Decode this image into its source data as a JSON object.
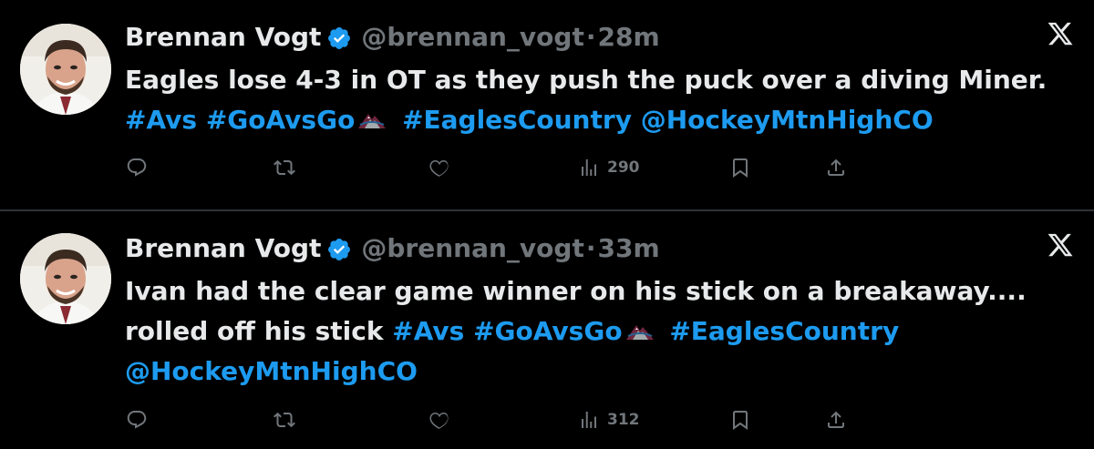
{
  "tweets": [
    {
      "author_name": "Brennan Vogt",
      "author_handle": "@brennan_vogt",
      "separator": "·",
      "time": "28m",
      "text_lines": [
        [
          {
            "text": "Eagles lose 4-3 in OT as they push the puck over a diving Miner.",
            "link": false
          }
        ],
        [
          {
            "text": "#Avs",
            "link": true
          },
          {
            "text": " ",
            "link": false
          },
          {
            "text": "#GoAvsGo",
            "link": true
          },
          {
            "emoji": "avalanche-logo-emoji"
          },
          {
            "text": " ",
            "link": false
          },
          {
            "text": "#EaglesCountry",
            "link": true
          },
          {
            "text": " ",
            "link": false
          },
          {
            "text": "@HockeyMtnHighCO",
            "link": true
          }
        ]
      ],
      "views": "290"
    },
    {
      "author_name": "Brennan Vogt",
      "author_handle": "@brennan_vogt",
      "separator": "·",
      "time": "33m",
      "text_lines": [
        [
          {
            "text": "Ivan had the clear game winner on his stick on a breakaway....",
            "link": false
          }
        ],
        [
          {
            "text": "rolled off his stick ",
            "link": false
          },
          {
            "text": "#Avs",
            "link": true
          },
          {
            "text": " ",
            "link": false
          },
          {
            "text": "#GoAvsGo",
            "link": true
          },
          {
            "emoji": "avalanche-logo-emoji"
          },
          {
            "text": " ",
            "link": false
          },
          {
            "text": "#EaglesCountry",
            "link": true
          }
        ],
        [
          {
            "text": "@HockeyMtnHighCO",
            "link": true
          }
        ]
      ],
      "views": "312"
    }
  ],
  "icons": {
    "verified": "verified-badge-icon",
    "platform": "x-logo-icon",
    "reply": "reply-icon",
    "retweet": "retweet-icon",
    "like": "heart-icon",
    "views": "views-bar-chart-icon",
    "bookmark": "bookmark-icon",
    "share": "share-icon"
  },
  "colors": {
    "background": "#000000",
    "text_primary": "#e7e9ea",
    "text_secondary": "#71767b",
    "link": "#1d9bf0",
    "verified": "#1d9bf0",
    "divider": "#2f3336"
  }
}
